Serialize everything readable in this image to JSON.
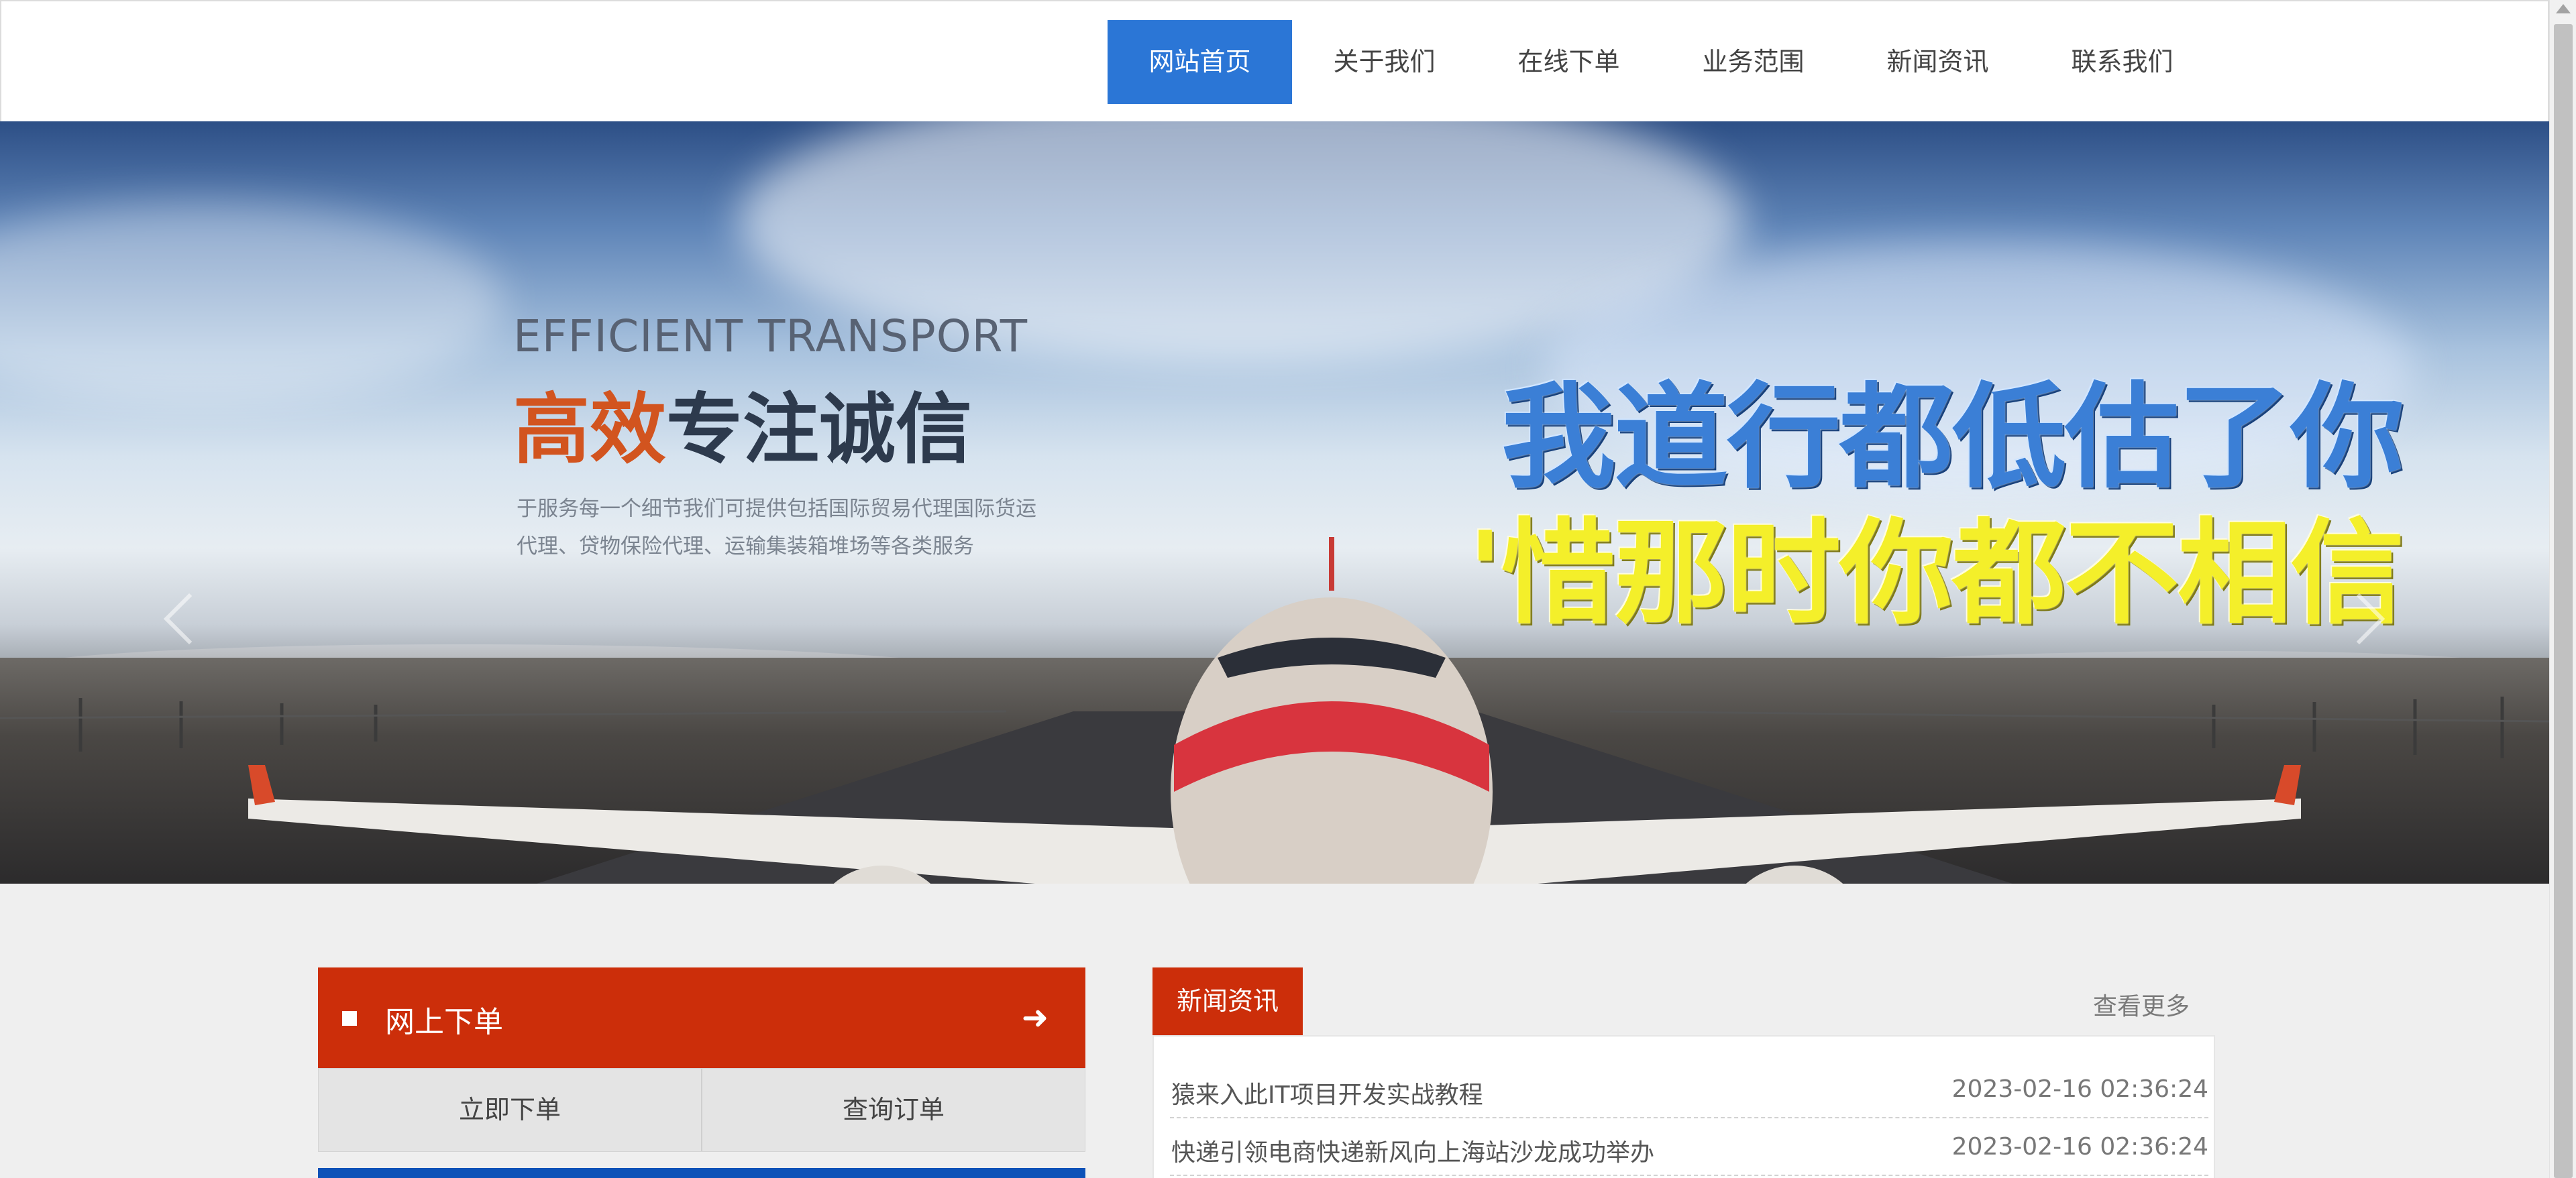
{
  "nav": {
    "items": [
      {
        "label": "网站首页",
        "active": true
      },
      {
        "label": "关于我们",
        "active": false
      },
      {
        "label": "在线下单",
        "active": false
      },
      {
        "label": "业务范围",
        "active": false
      },
      {
        "label": "新闻资讯",
        "active": false
      },
      {
        "label": "联系我们",
        "active": false
      }
    ],
    "active_color": "#2b76d6"
  },
  "banner": {
    "subtitle_en": "EFFICIENT TRANSPORT",
    "title_accent": "高效",
    "title_rest": "专注诚信",
    "description_line1": "于服务每一个细节我们可提供包括国际贸易代理国际货运",
    "description_line2": "代理、贷物保险代理、运输集装箱堆场等各类服务",
    "slogan_line1": "我道行都低估了你",
    "slogan_line2": "'惜那时你都不相信",
    "slide_count": 3,
    "active_slide": 3
  },
  "order_panel": {
    "title": "网上下单",
    "arrow_icon": "arrow-right-icon",
    "buttons": [
      "立即下单",
      "查询订单"
    ],
    "header_color": "#cc2e0a"
  },
  "news": {
    "tab_label": "新闻资讯",
    "more_label": "查看更多",
    "items": [
      {
        "title": "猿来入此IT项目开发实战教程",
        "date": "2023-02-16 02:36:24"
      },
      {
        "title": "快递引领电商快递新风向上海站沙龙成功举办",
        "date": "2023-02-16 02:36:24"
      }
    ]
  }
}
